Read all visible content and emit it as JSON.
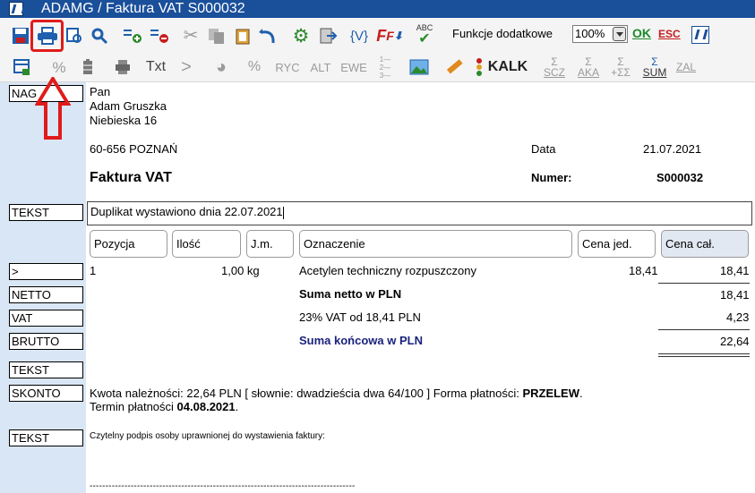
{
  "window": {
    "title": "ADAMG / Faktura VAT S000032"
  },
  "toolbar": {
    "row1": [
      {
        "name": "save-icon",
        "glyph": "▮"
      },
      {
        "name": "printer-icon",
        "glyph": "🖶"
      },
      {
        "name": "print-preview-icon",
        "glyph": "🖶"
      },
      {
        "name": "search-icon",
        "glyph": "⚲"
      },
      {
        "name": "add-row-icon",
        "glyph": "⊞"
      },
      {
        "name": "delete-row-icon",
        "glyph": "⊟"
      },
      {
        "name": "scissors-icon",
        "glyph": "✂"
      },
      {
        "name": "copy-icon",
        "glyph": "❐"
      },
      {
        "name": "paste-icon",
        "glyph": "📋"
      },
      {
        "name": "undo-icon",
        "glyph": "↶"
      },
      {
        "name": "gear-icon",
        "glyph": "⚙"
      },
      {
        "name": "export-icon",
        "glyph": "⇥"
      },
      {
        "name": "variables-icon",
        "glyph": "{V}"
      },
      {
        "name": "font-down-icon",
        "glyph": "F↓"
      },
      {
        "name": "spellcheck-icon",
        "glyph": "✔"
      }
    ],
    "functions_label": "Funkcje dodatkowe",
    "zoom_value": "100%",
    "ok_label": "OK",
    "esc_label": "ESC",
    "row2": [
      {
        "name": "new-document-icon",
        "glyph": "▦"
      },
      {
        "name": "percent-disabled-icon",
        "glyph": "%"
      },
      {
        "name": "battery-icon",
        "glyph": "▯"
      },
      {
        "name": "printer-small-icon",
        "glyph": "▬"
      },
      {
        "name": "text-icon",
        "glyph": "Txt"
      },
      {
        "name": "chevron-right-icon",
        "glyph": ">"
      },
      {
        "name": "palette-icon",
        "glyph": "◕"
      },
      {
        "name": "percent-icon",
        "glyph": "%"
      },
      {
        "name": "ryc-icon",
        "glyph": "RYC"
      },
      {
        "name": "alt-icon",
        "glyph": "ALT"
      },
      {
        "name": "ewe-icon",
        "glyph": "EWE"
      },
      {
        "name": "numbered-list-icon",
        "glyph": "⋮"
      },
      {
        "name": "image-icon",
        "glyph": "▣"
      },
      {
        "name": "ruler-icon",
        "glyph": "✎"
      },
      {
        "name": "traffic-light-icon",
        "glyph": "⋮"
      }
    ],
    "kalk_label": "KALK",
    "row2_right": [
      {
        "name": "scz-icon",
        "top": "Σ",
        "bottom": "SCZ"
      },
      {
        "name": "aka-icon",
        "top": "Σ",
        "bottom": "AKA"
      },
      {
        "name": "sum-sum-icon",
        "top": "Σ",
        "bottom": "+ΣΣ"
      },
      {
        "name": "sum-icon",
        "top": "Σ",
        "bottom": "SUM"
      },
      {
        "name": "zal-icon",
        "top": "",
        "bottom": "ZAL"
      }
    ]
  },
  "labels": {
    "nag": "NAG",
    "tekst1": "TEKST",
    "pos": ">",
    "netto": "NETTO",
    "vat": "VAT",
    "brutto": "BRUTTO",
    "tekst2": "TEKST",
    "skonto": "SKONTO",
    "tekst3": "TEKST"
  },
  "address": {
    "line1": "Pan",
    "line2": "Adam Gruszka",
    "line3": "Niebieska 16",
    "postal": "60-656 POZNAŃ"
  },
  "doc": {
    "title": "Faktura VAT",
    "date_label": "Data",
    "date_value": "21.07.2021",
    "number_label": "Numer:",
    "number_value": "S000032"
  },
  "text_field": "Duplikat wystawiono dnia 22.07.2021",
  "columns": [
    "Pozycja",
    "Ilość",
    "J.m.",
    "Oznaczenie",
    "Cena jed.",
    "Cena cał."
  ],
  "item": {
    "pos": "1",
    "qty": "1,00 kg",
    "name": "Acetylen techniczny rozpuszczony",
    "unit_price": "18,41",
    "total": "18,41"
  },
  "summary": {
    "netto_label": "Suma netto w PLN",
    "netto_value": "18,41",
    "vat_label": "23% VAT od 18,41 PLN",
    "vat_value": "4,23",
    "brutto_label": "Suma końcowa w PLN",
    "brutto_value": "22,64"
  },
  "skonto": {
    "prefix": "Kwota należności: 22,64 PLN [ słownie: dwadzieścia dwa 64/100 ] Forma płatności: ",
    "method": "PRZELEW",
    "suffix": ".",
    "term_label": "Termin płatności ",
    "term_value": "04.08.2021",
    "term_suffix": "."
  },
  "signature": {
    "text": "Czytelny podpis osoby uprawnionej do wystawienia faktury:",
    "line": "------------------------------------------------------------------------------------"
  }
}
